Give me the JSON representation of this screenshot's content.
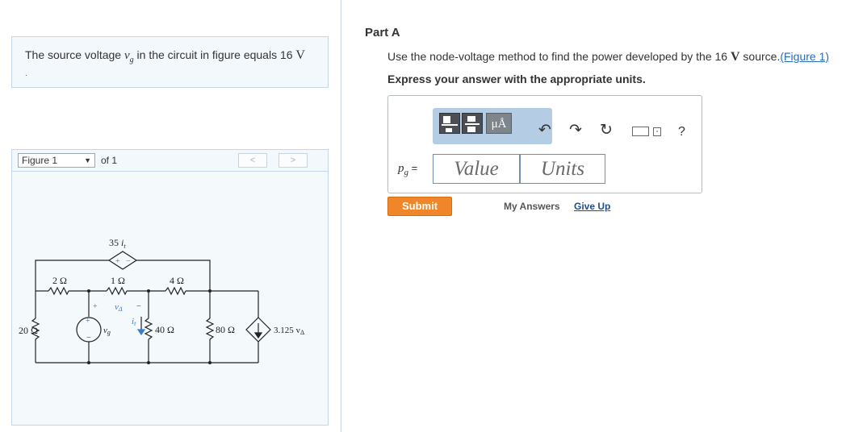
{
  "problem": {
    "text_prefix": "The source voltage ",
    "var": "v",
    "var_sub": "g",
    "text_mid": " in the circuit in figure equals 16 ",
    "unit": "V",
    "trailing": "."
  },
  "figure_nav": {
    "selected": "Figure 1",
    "of_text": "of 1",
    "prev_label": "<",
    "next_label": ">"
  },
  "circuit": {
    "dep_source_label": "35",
    "dep_source_var": "i",
    "dep_source_sub": "t",
    "r1": "2 Ω",
    "r2": "1 Ω",
    "r3": "4 Ω",
    "r4": "20 Ω",
    "r5": "40 Ω",
    "r6": "80 Ω",
    "va_label": "v",
    "va_sub": "Δ",
    "vg_label": "v",
    "vg_sub": "g",
    "it_label": "i",
    "it_sub": "t",
    "dep_current_label": "3.125 v",
    "dep_current_sub": "Δ",
    "plus": "+",
    "minus": "−"
  },
  "part": {
    "title": "Part A",
    "instruction_prefix": "Use the node-voltage method to find the power developed by the 16 ",
    "instruction_unit": "V",
    "instruction_suffix": " source.",
    "figure_link": "(Figure 1)",
    "express": "Express your answer with the appropriate units."
  },
  "answer": {
    "label_var": "p",
    "label_sub": "g",
    "label_eq": " =",
    "value_placeholder": "Value",
    "units_placeholder": "Units",
    "mu_symbol": "μÅ",
    "help": "?"
  },
  "actions": {
    "submit": "Submit",
    "my_answers": "My Answers",
    "give_up": "Give Up"
  },
  "colors": {
    "submit": "#f0862a",
    "link": "#2a6bb5",
    "toolbar": "#b5cde4"
  }
}
